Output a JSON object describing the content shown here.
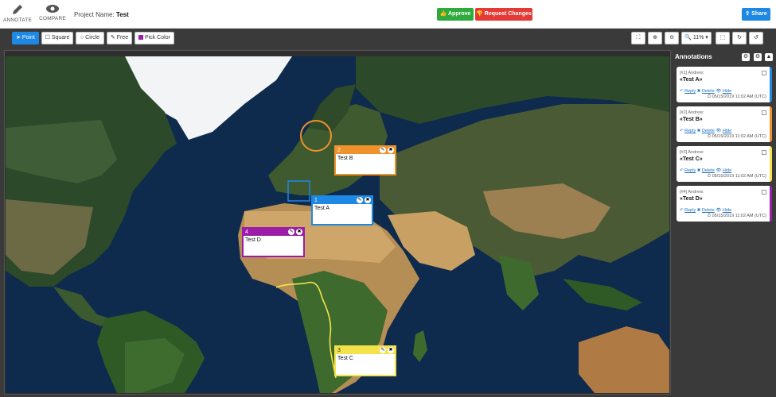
{
  "header": {
    "annotate_label": "ANNOTATE",
    "compare_label": "COMPARE",
    "project_prefix": "Project Name:",
    "project_name": "Test",
    "approve_label": "Approve",
    "request_label": "Request Changes",
    "share_label": "Share",
    "approve_color": "#2eab3c",
    "request_color": "#e53935",
    "share_color": "#1e88e5"
  },
  "tools": {
    "point": "Point",
    "square": "Square",
    "circle": "Circle",
    "free": "Free",
    "pick_color": "Pick Color",
    "zoom_level": "11%"
  },
  "notes": [
    {
      "num": "2",
      "text": "Test B",
      "color": "#f0922b"
    },
    {
      "num": "1",
      "text": "Test A",
      "color": "#1e88e5"
    },
    {
      "num": "4",
      "text": "Test D",
      "color": "#9c1da8"
    },
    {
      "num": "3",
      "text": "Test C",
      "color": "#f3e24a"
    }
  ],
  "sidebar": {
    "title": "Annotations",
    "cards": [
      {
        "who": "[#1] Andrew:",
        "title": "«Test A»",
        "reply": "Reply",
        "delete": "Delete",
        "hide": "Hide",
        "time": "05/15/2019 11:02 AM (UTC)",
        "color": "#1e88e5"
      },
      {
        "who": "[#2] Andrew:",
        "title": "«Test B»",
        "reply": "Reply",
        "delete": "Delete",
        "hide": "Hide",
        "time": "05/15/2019 11:02 AM (UTC)",
        "color": "#f0922b"
      },
      {
        "who": "[#3] Andrew:",
        "title": "«Test C»",
        "reply": "Reply",
        "delete": "Delete",
        "hide": "Hide",
        "time": "05/15/2019 11:02 AM (UTC)",
        "color": "#f3e24a"
      },
      {
        "who": "[#4] Andrew:",
        "title": "«Test D»",
        "reply": "Reply",
        "delete": "Delete",
        "hide": "Hide",
        "time": "05/15/2019 11:02 AM (UTC)",
        "color": "#9c1da8"
      }
    ]
  }
}
